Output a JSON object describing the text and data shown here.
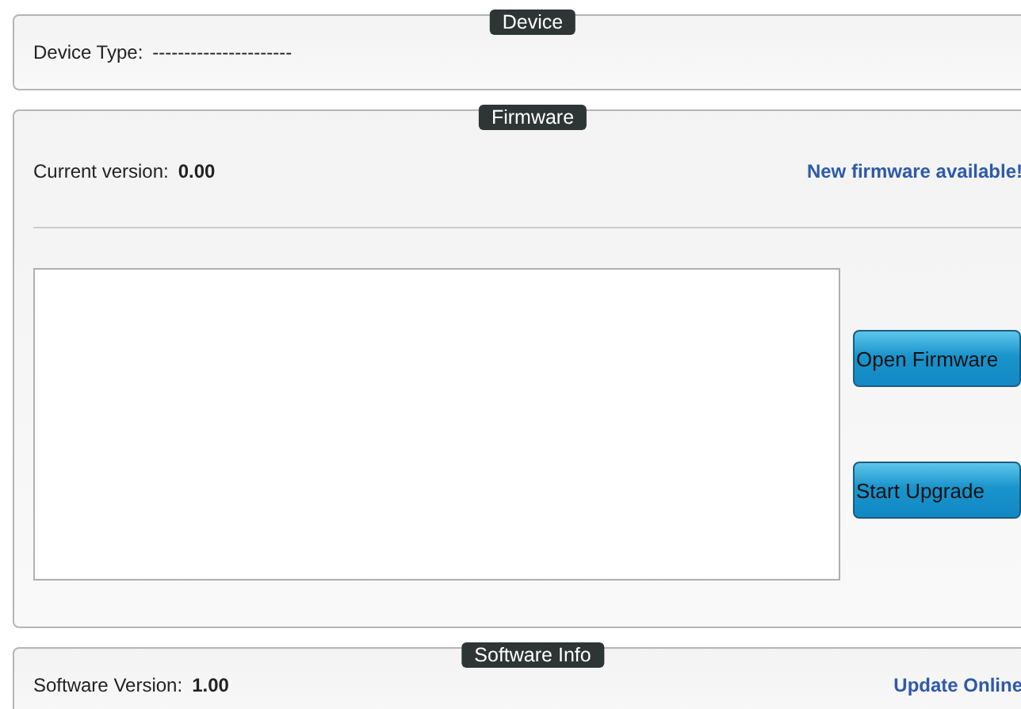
{
  "device": {
    "title": "Device",
    "type_label": "Device Type:",
    "type_value": "----------------------"
  },
  "firmware": {
    "title": "Firmware",
    "version_label": "Current version:",
    "version_value": "0.00",
    "notice": "New firmware available!",
    "buttons": [
      "Open Firmware",
      "Start Upgrade"
    ]
  },
  "software": {
    "title": "Software Info",
    "version_label": "Software Version:",
    "version_value": "1.00",
    "link": "Update Online"
  }
}
